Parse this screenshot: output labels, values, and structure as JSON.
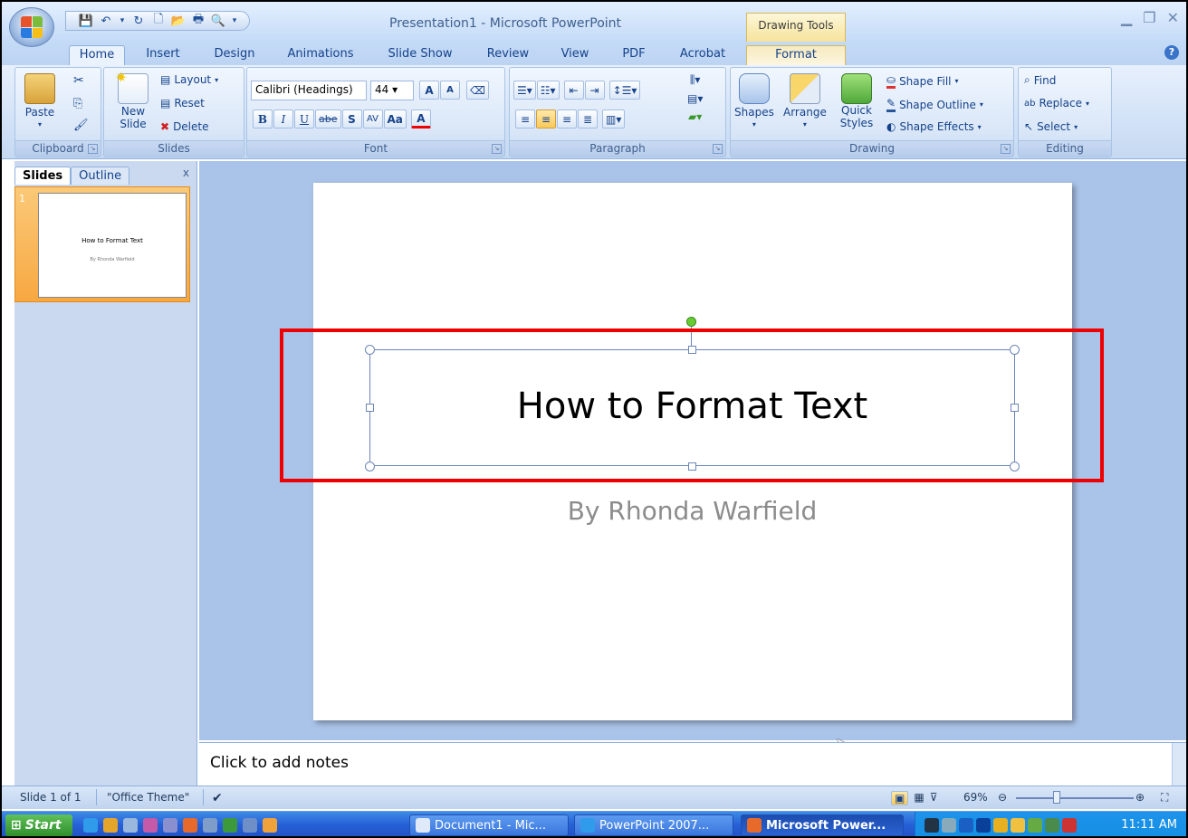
{
  "window": {
    "title": "Presentation1 - Microsoft PowerPoint",
    "contextual_tab_group": "Drawing Tools"
  },
  "tabs": [
    "Home",
    "Insert",
    "Design",
    "Animations",
    "Slide Show",
    "Review",
    "View",
    "PDF",
    "Acrobat",
    "Format"
  ],
  "active_tab": "Home",
  "ribbon": {
    "clipboard": {
      "label": "Clipboard",
      "paste": "Paste"
    },
    "slides": {
      "label": "Slides",
      "new_slide": "New Slide",
      "layout": "Layout",
      "reset": "Reset",
      "delete": "Delete"
    },
    "font": {
      "label": "Font",
      "family": "Calibri (Headings)",
      "size": "44",
      "bold": "B",
      "italic": "I",
      "underline": "U",
      "strikethrough": "abe",
      "shadow": "S",
      "spacing": "AV",
      "change_case": "Aa",
      "font_color": "A",
      "grow": "A",
      "shrink": "A"
    },
    "paragraph": {
      "label": "Paragraph"
    },
    "drawing": {
      "label": "Drawing",
      "shapes": "Shapes",
      "arrange": "Arrange",
      "quick_styles": "Quick Styles",
      "shape_fill": "Shape Fill",
      "shape_outline": "Shape Outline",
      "shape_effects": "Shape Effects"
    },
    "editing": {
      "label": "Editing",
      "find": "Find",
      "replace": "Replace",
      "select": "Select"
    }
  },
  "slides_pane": {
    "tabs": [
      "Slides",
      "Outline"
    ],
    "close": "x",
    "thumbnail": {
      "number": "1",
      "title": "How to Format Text",
      "subtitle": "By Rhonda Warfield"
    }
  },
  "slide": {
    "title": "How to Format Text",
    "subtitle": "By Rhonda Warfield"
  },
  "notes": {
    "placeholder": "Click to add notes"
  },
  "status": {
    "slide_info": "Slide 1 of 1",
    "theme": "\"Office Theme\"",
    "zoom": "69%",
    "zoom_level": 0.69
  },
  "taskbar": {
    "start": "Start",
    "tasks": [
      "Document1 - Mic...",
      "PowerPoint 2007...",
      "Microsoft Power..."
    ],
    "clock": "11:11 AM"
  },
  "colors": {
    "ribbon_blue": "#c4dbf7",
    "highlight_red": "#ee0000",
    "selection_tab": "#f6e39b",
    "thumb_selected": "#f7a842"
  }
}
